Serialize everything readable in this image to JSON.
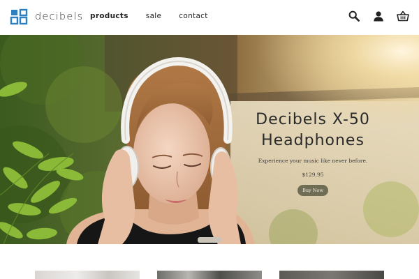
{
  "brand": {
    "name": "decibels",
    "logo_icon": "decibels-logo-icon",
    "logo_color": "#2e7fc0"
  },
  "nav": {
    "items": [
      {
        "label": "products",
        "active": true
      },
      {
        "label": "sale",
        "active": false
      },
      {
        "label": "contact",
        "active": false
      }
    ]
  },
  "tools": {
    "search_icon": "search-icon",
    "account_icon": "user-icon",
    "cart_icon": "basket-icon"
  },
  "hero": {
    "title_line1": "Decibels X-50",
    "title_line2": "Headphones",
    "subtitle": "Experience your music like never before.",
    "price": "$129.95",
    "cta_label": "Buy Now",
    "cta_color": "#6f6e55"
  },
  "products": {
    "cards": [
      {
        "name": "product-card-1"
      },
      {
        "name": "product-card-2"
      },
      {
        "name": "product-card-3"
      }
    ]
  }
}
